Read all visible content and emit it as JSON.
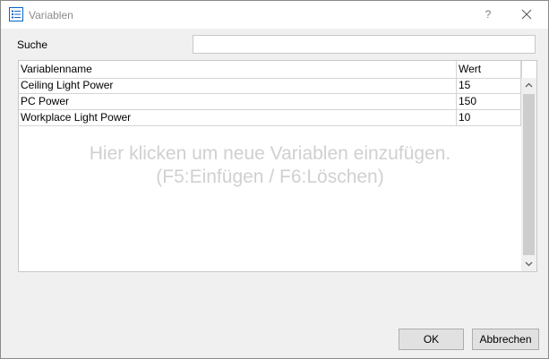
{
  "window": {
    "title": "Variablen",
    "help_label": "?",
    "app_icon": "list-icon",
    "close_icon": "close-icon"
  },
  "search": {
    "label": "Suche",
    "value": "",
    "placeholder": ""
  },
  "table": {
    "columns": [
      "Variablenname",
      "Wert"
    ],
    "rows": [
      {
        "name": "Ceiling Light Power",
        "value": "15"
      },
      {
        "name": "PC Power",
        "value": "150"
      },
      {
        "name": "Workplace Light Power",
        "value": "10"
      }
    ],
    "hint_line1": "Hier klicken um neue Variablen einzufügen.",
    "hint_line2": "(F5:Einfügen / F6:Löschen)"
  },
  "buttons": {
    "ok": "OK",
    "cancel": "Abbrechen"
  },
  "colors": {
    "accent": "#0a64c8",
    "hint_text": "#d0d0d0",
    "title_text": "#8c8c8c"
  }
}
